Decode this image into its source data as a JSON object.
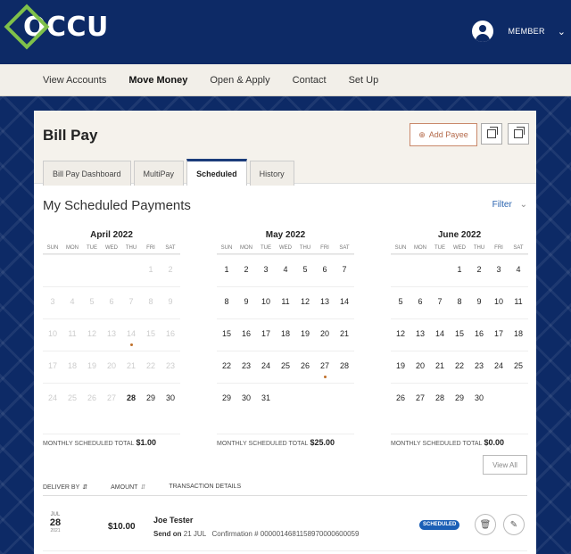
{
  "brand": {
    "name": "OCCU"
  },
  "user": {
    "label": "MEMBER"
  },
  "nav": [
    "View Accounts",
    "Move Money",
    "Open & Apply",
    "Contact",
    "Set Up"
  ],
  "page": {
    "title": "Bill Pay",
    "add_payee": "Add Payee",
    "tabs": [
      "Bill Pay Dashboard",
      "MultiPay",
      "Scheduled",
      "History"
    ],
    "section_title": "My Scheduled Payments",
    "filter": "Filter",
    "total_label": "MONTHLY SCHEDULED TOTAL",
    "view_all": "View All"
  },
  "dow": [
    "SUN",
    "MON",
    "TUE",
    "WED",
    "THU",
    "FRI",
    "SAT"
  ],
  "months": [
    {
      "name": "April 2022",
      "start": 5,
      "days": 30,
      "active_from": 28,
      "bold": [
        28
      ],
      "dots": [
        14
      ],
      "total": "$1.00"
    },
    {
      "name": "May 2022",
      "start": 0,
      "days": 31,
      "active_from": 1,
      "bold": [],
      "dots": [
        27
      ],
      "total": "$25.00"
    },
    {
      "name": "June 2022",
      "start": 3,
      "days": 30,
      "active_from": 1,
      "bold": [],
      "dots": [],
      "total": "$0.00"
    }
  ],
  "table": {
    "headers": [
      "DELIVER BY",
      "AMOUNT",
      "TRANSACTION DETAILS"
    ],
    "rows": [
      {
        "month": "JUL",
        "day": "28",
        "year": "2021",
        "amount": "$10.00",
        "payee": "Joe Tester",
        "send_label": "Send on",
        "send_date": "21 JUL",
        "confirmation": "Confirmation # 0000014681158970000600059",
        "status": "SCHEDULED"
      }
    ]
  },
  "colors": {
    "brand_navy": "#0d2a66",
    "accent_green": "#7fc04a",
    "badge_blue": "#1b5fb6"
  }
}
